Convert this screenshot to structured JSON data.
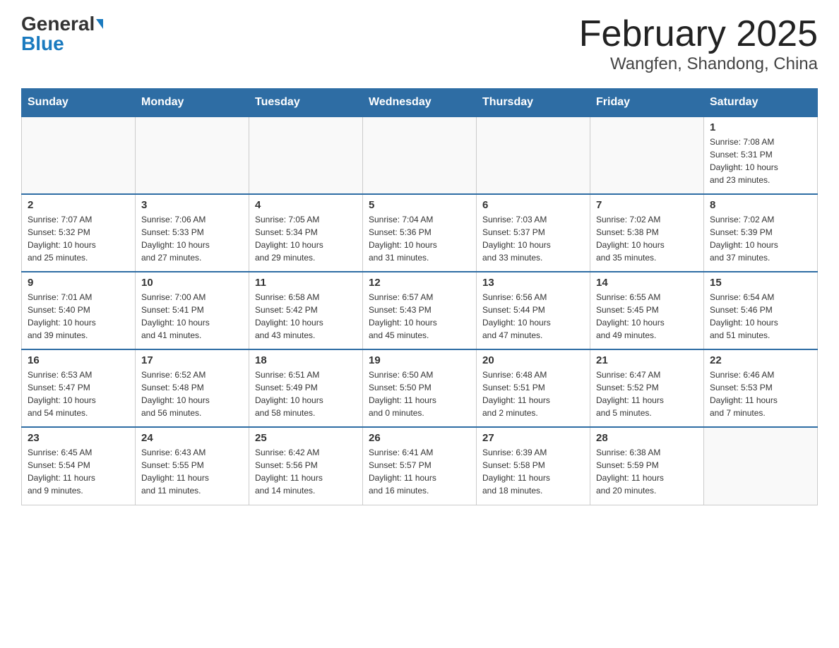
{
  "header": {
    "logo_general": "General",
    "logo_blue": "Blue",
    "month_title": "February 2025",
    "location": "Wangfen, Shandong, China"
  },
  "weekdays": [
    "Sunday",
    "Monday",
    "Tuesday",
    "Wednesday",
    "Thursday",
    "Friday",
    "Saturday"
  ],
  "weeks": [
    {
      "days": [
        {
          "num": "",
          "info": ""
        },
        {
          "num": "",
          "info": ""
        },
        {
          "num": "",
          "info": ""
        },
        {
          "num": "",
          "info": ""
        },
        {
          "num": "",
          "info": ""
        },
        {
          "num": "",
          "info": ""
        },
        {
          "num": "1",
          "info": "Sunrise: 7:08 AM\nSunset: 5:31 PM\nDaylight: 10 hours\nand 23 minutes."
        }
      ]
    },
    {
      "days": [
        {
          "num": "2",
          "info": "Sunrise: 7:07 AM\nSunset: 5:32 PM\nDaylight: 10 hours\nand 25 minutes."
        },
        {
          "num": "3",
          "info": "Sunrise: 7:06 AM\nSunset: 5:33 PM\nDaylight: 10 hours\nand 27 minutes."
        },
        {
          "num": "4",
          "info": "Sunrise: 7:05 AM\nSunset: 5:34 PM\nDaylight: 10 hours\nand 29 minutes."
        },
        {
          "num": "5",
          "info": "Sunrise: 7:04 AM\nSunset: 5:36 PM\nDaylight: 10 hours\nand 31 minutes."
        },
        {
          "num": "6",
          "info": "Sunrise: 7:03 AM\nSunset: 5:37 PM\nDaylight: 10 hours\nand 33 minutes."
        },
        {
          "num": "7",
          "info": "Sunrise: 7:02 AM\nSunset: 5:38 PM\nDaylight: 10 hours\nand 35 minutes."
        },
        {
          "num": "8",
          "info": "Sunrise: 7:02 AM\nSunset: 5:39 PM\nDaylight: 10 hours\nand 37 minutes."
        }
      ]
    },
    {
      "days": [
        {
          "num": "9",
          "info": "Sunrise: 7:01 AM\nSunset: 5:40 PM\nDaylight: 10 hours\nand 39 minutes."
        },
        {
          "num": "10",
          "info": "Sunrise: 7:00 AM\nSunset: 5:41 PM\nDaylight: 10 hours\nand 41 minutes."
        },
        {
          "num": "11",
          "info": "Sunrise: 6:58 AM\nSunset: 5:42 PM\nDaylight: 10 hours\nand 43 minutes."
        },
        {
          "num": "12",
          "info": "Sunrise: 6:57 AM\nSunset: 5:43 PM\nDaylight: 10 hours\nand 45 minutes."
        },
        {
          "num": "13",
          "info": "Sunrise: 6:56 AM\nSunset: 5:44 PM\nDaylight: 10 hours\nand 47 minutes."
        },
        {
          "num": "14",
          "info": "Sunrise: 6:55 AM\nSunset: 5:45 PM\nDaylight: 10 hours\nand 49 minutes."
        },
        {
          "num": "15",
          "info": "Sunrise: 6:54 AM\nSunset: 5:46 PM\nDaylight: 10 hours\nand 51 minutes."
        }
      ]
    },
    {
      "days": [
        {
          "num": "16",
          "info": "Sunrise: 6:53 AM\nSunset: 5:47 PM\nDaylight: 10 hours\nand 54 minutes."
        },
        {
          "num": "17",
          "info": "Sunrise: 6:52 AM\nSunset: 5:48 PM\nDaylight: 10 hours\nand 56 minutes."
        },
        {
          "num": "18",
          "info": "Sunrise: 6:51 AM\nSunset: 5:49 PM\nDaylight: 10 hours\nand 58 minutes."
        },
        {
          "num": "19",
          "info": "Sunrise: 6:50 AM\nSunset: 5:50 PM\nDaylight: 11 hours\nand 0 minutes."
        },
        {
          "num": "20",
          "info": "Sunrise: 6:48 AM\nSunset: 5:51 PM\nDaylight: 11 hours\nand 2 minutes."
        },
        {
          "num": "21",
          "info": "Sunrise: 6:47 AM\nSunset: 5:52 PM\nDaylight: 11 hours\nand 5 minutes."
        },
        {
          "num": "22",
          "info": "Sunrise: 6:46 AM\nSunset: 5:53 PM\nDaylight: 11 hours\nand 7 minutes."
        }
      ]
    },
    {
      "days": [
        {
          "num": "23",
          "info": "Sunrise: 6:45 AM\nSunset: 5:54 PM\nDaylight: 11 hours\nand 9 minutes."
        },
        {
          "num": "24",
          "info": "Sunrise: 6:43 AM\nSunset: 5:55 PM\nDaylight: 11 hours\nand 11 minutes."
        },
        {
          "num": "25",
          "info": "Sunrise: 6:42 AM\nSunset: 5:56 PM\nDaylight: 11 hours\nand 14 minutes."
        },
        {
          "num": "26",
          "info": "Sunrise: 6:41 AM\nSunset: 5:57 PM\nDaylight: 11 hours\nand 16 minutes."
        },
        {
          "num": "27",
          "info": "Sunrise: 6:39 AM\nSunset: 5:58 PM\nDaylight: 11 hours\nand 18 minutes."
        },
        {
          "num": "28",
          "info": "Sunrise: 6:38 AM\nSunset: 5:59 PM\nDaylight: 11 hours\nand 20 minutes."
        },
        {
          "num": "",
          "info": ""
        }
      ]
    }
  ]
}
